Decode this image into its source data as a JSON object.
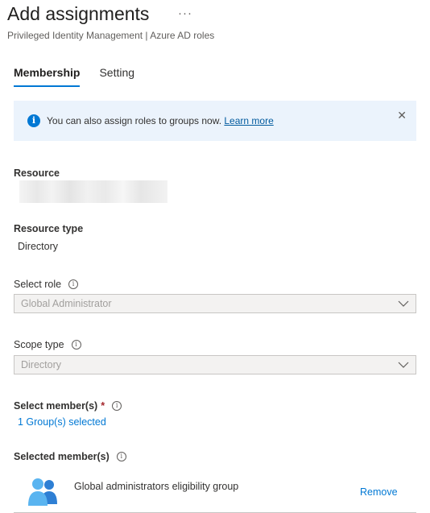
{
  "header": {
    "title": "Add assignments",
    "more": "···",
    "subtitle": "Privileged Identity Management | Azure AD roles"
  },
  "tabs": [
    {
      "label": "Membership",
      "active": true
    },
    {
      "label": "Setting",
      "active": false
    }
  ],
  "banner": {
    "text": "You can also assign roles to groups now.",
    "link": "Learn more",
    "close": "✕"
  },
  "resource": {
    "label": "Resource"
  },
  "resource_type": {
    "label": "Resource type",
    "value": "Directory"
  },
  "select_role": {
    "label": "Select role",
    "value": "Global Administrator"
  },
  "scope_type": {
    "label": "Scope type",
    "value": "Directory"
  },
  "select_members": {
    "label": "Select member(s)",
    "required": "*",
    "link": "1 Group(s) selected"
  },
  "selected_members": {
    "label": "Selected member(s)",
    "items": [
      {
        "name": "Global administrators eligibility group",
        "action": "Remove",
        "icon": "group-icon"
      }
    ]
  },
  "colors": {
    "accent": "#0078d4",
    "banner_bg": "#ebf3fc",
    "required": "#a4262c"
  }
}
